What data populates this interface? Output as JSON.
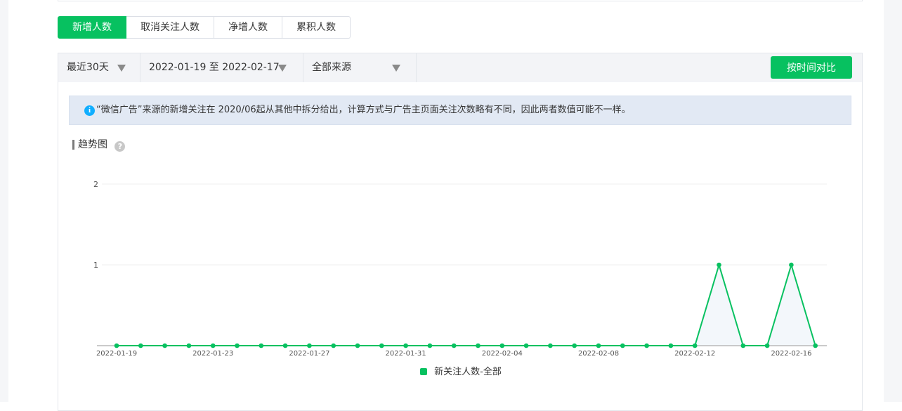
{
  "tabs": [
    {
      "label": "新增人数",
      "active": true
    },
    {
      "label": "取消关注人数",
      "active": false
    },
    {
      "label": "净增人数",
      "active": false
    },
    {
      "label": "累积人数",
      "active": false
    }
  ],
  "filters": {
    "period": "最近30天",
    "date_range": "2022-01-19 至 2022-02-17",
    "source": "全部来源"
  },
  "compare_button": "按时间对比",
  "notice": "“微信广告”来源的新增关注在 2020/06起从其他中拆分给出，计算方式与广告主页面关注次数略有不同，因此两者数值可能不一样。",
  "section_title": "趋势图",
  "colors": {
    "accent": "#07c160",
    "notice_bg": "#e2e9f4",
    "info": "#10aeff"
  },
  "chart_data": {
    "type": "line",
    "x": [
      "2022-01-19",
      "2022-01-20",
      "2022-01-21",
      "2022-01-22",
      "2022-01-23",
      "2022-01-24",
      "2022-01-25",
      "2022-01-26",
      "2022-01-27",
      "2022-01-28",
      "2022-01-29",
      "2022-01-30",
      "2022-01-31",
      "2022-02-01",
      "2022-02-02",
      "2022-02-03",
      "2022-02-04",
      "2022-02-05",
      "2022-02-06",
      "2022-02-07",
      "2022-02-08",
      "2022-02-09",
      "2022-02-10",
      "2022-02-11",
      "2022-02-12",
      "2022-02-13",
      "2022-02-14",
      "2022-02-15",
      "2022-02-16",
      "2022-02-17"
    ],
    "x_tick_labels": [
      "2022-01-19",
      "2022-01-23",
      "2022-01-27",
      "2022-01-31",
      "2022-02-04",
      "2022-02-08",
      "2022-02-12",
      "2022-02-16"
    ],
    "y_ticks": [
      "1",
      "2"
    ],
    "ylim": [
      0,
      2
    ],
    "series": [
      {
        "name": "新关注人数-全部",
        "color": "#07c160",
        "values": [
          0,
          0,
          0,
          0,
          0,
          0,
          0,
          0,
          0,
          0,
          0,
          0,
          0,
          0,
          0,
          0,
          0,
          0,
          0,
          0,
          0,
          0,
          0,
          0,
          0,
          1,
          0,
          0,
          1,
          0
        ]
      }
    ],
    "legend": "bottom-center",
    "grid": true
  }
}
